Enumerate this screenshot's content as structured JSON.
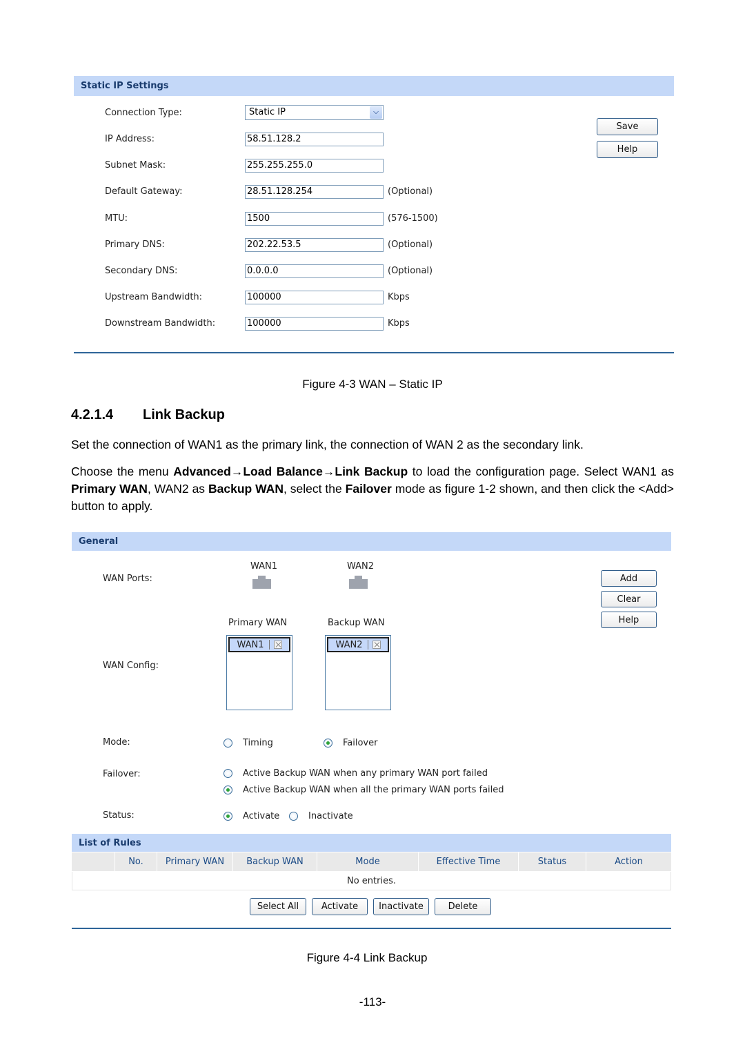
{
  "figure1": {
    "panel_title": "Static IP Settings",
    "fields": [
      {
        "label": "Connection Type:",
        "type": "select",
        "value": "Static IP",
        "note": ""
      },
      {
        "label": "IP Address:",
        "type": "text",
        "value": "58.51.128.2",
        "note": ""
      },
      {
        "label": "Subnet Mask:",
        "type": "text",
        "value": "255.255.255.0",
        "note": ""
      },
      {
        "label": "Default Gateway:",
        "type": "text",
        "value": "28.51.128.254",
        "note": "(Optional)"
      },
      {
        "label": "MTU:",
        "type": "text",
        "value": "1500",
        "note": "(576-1500)"
      },
      {
        "label": "Primary DNS:",
        "type": "text",
        "value": "202.22.53.5",
        "note": "(Optional)"
      },
      {
        "label": "Secondary DNS:",
        "type": "text",
        "value": "0.0.0.0",
        "note": "(Optional)"
      },
      {
        "label": "Upstream Bandwidth:",
        "type": "text",
        "value": "100000",
        "note": "Kbps"
      },
      {
        "label": "Downstream Bandwidth:",
        "type": "text",
        "value": "100000",
        "note": "Kbps"
      }
    ],
    "buttons": {
      "save": "Save",
      "help": "Help"
    },
    "caption": "Figure 4-3 WAN – Static IP"
  },
  "section": {
    "number": "4.2.1.4",
    "title": "Link Backup",
    "para1": "Set the connection of WAN1 as the primary link, the connection of WAN 2 as the secondary link.",
    "para2": {
      "t1": "Choose the menu ",
      "b1": "Advanced→Load Balance→Link Backup",
      "t2": " to load the configuration page. Select WAN1 as ",
      "b2": "Primary WAN",
      "t3": ", WAN2 as ",
      "b3": "Backup WAN",
      "t4": ", select the ",
      "b4": "Failover",
      "t5": " mode as figure 1-2 shown, and then click the <Add> button to apply."
    }
  },
  "figure2": {
    "general_title": "General",
    "wan_ports_label": "WAN Ports:",
    "ports": [
      "WAN1",
      "WAN2"
    ],
    "primary_wan_label": "Primary WAN",
    "backup_wan_label": "Backup WAN",
    "wan_config_label": "WAN Config:",
    "primary_selected": "WAN1",
    "backup_selected": "WAN2",
    "buttons": {
      "add": "Add",
      "clear": "Clear",
      "help": "Help"
    },
    "mode_label": "Mode:",
    "mode_options": [
      {
        "label": "Timing",
        "selected": false
      },
      {
        "label": "Failover",
        "selected": true
      }
    ],
    "failover_label": "Failover:",
    "failover_options": [
      {
        "label": "Active Backup WAN when any primary WAN port failed",
        "selected": false
      },
      {
        "label": "Active Backup WAN when all the primary WAN ports failed",
        "selected": true
      }
    ],
    "status_label": "Status:",
    "status_options": [
      {
        "label": "Activate",
        "selected": true
      },
      {
        "label": "Inactivate",
        "selected": false
      }
    ],
    "list_title": "List of Rules",
    "columns": [
      "",
      "No.",
      "Primary WAN",
      "Backup WAN",
      "Mode",
      "Effective Time",
      "Status",
      "Action"
    ],
    "empty_text": "No entries.",
    "bottom_buttons": [
      "Select All",
      "Activate",
      "Inactivate",
      "Delete"
    ],
    "caption": "Figure 4-4 Link Backup"
  },
  "page_number": "-113-"
}
